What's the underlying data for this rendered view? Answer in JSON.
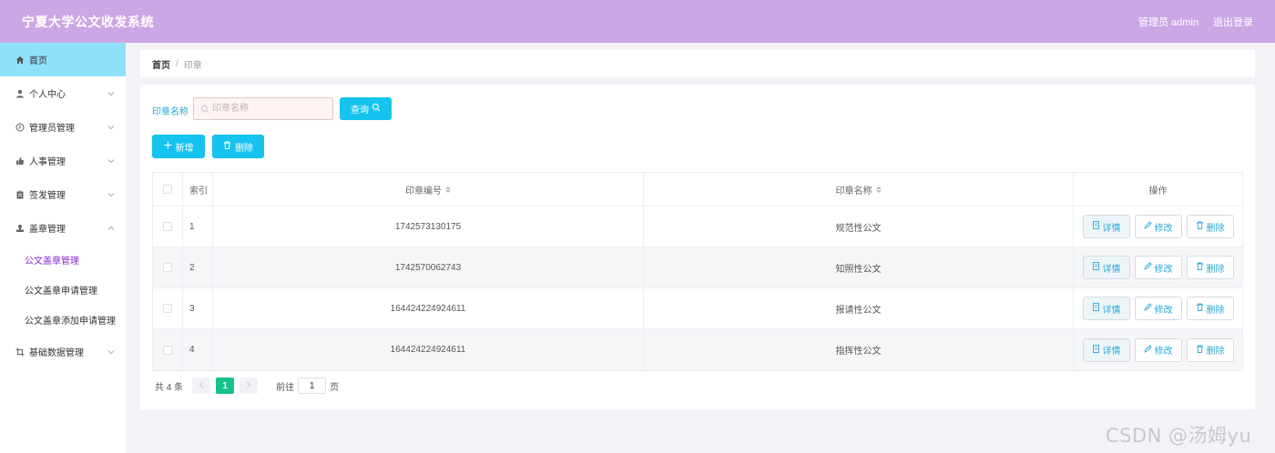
{
  "header": {
    "title": "宁夏大学公文收发系统",
    "user_label": "管理员 admin",
    "logout_label": "退出登录"
  },
  "sidebar": {
    "items": [
      {
        "label": "首页",
        "icon": "home-icon",
        "active": true
      },
      {
        "label": "个人中心",
        "icon": "user-icon"
      },
      {
        "label": "管理员管理",
        "icon": "clock-icon"
      },
      {
        "label": "人事管理",
        "icon": "thumb-icon"
      },
      {
        "label": "签发管理",
        "icon": "clipboard-icon"
      },
      {
        "label": "盖章管理",
        "icon": "stamp-icon",
        "expanded": true
      },
      {
        "label": "基础数据管理",
        "icon": "crop-icon"
      }
    ],
    "sub_items": [
      {
        "label": "公文盖章管理",
        "current": true
      },
      {
        "label": "公文盖章申请管理"
      },
      {
        "label": "公文盖章添加申请管理"
      }
    ]
  },
  "breadcrumb": {
    "home": "首页",
    "separator": "/",
    "current": "印章"
  },
  "search": {
    "label": "印章名称",
    "placeholder": "印章名称",
    "value": "",
    "query_label": "查询"
  },
  "actions": {
    "add_label": "新增",
    "delete_label": "删除"
  },
  "table": {
    "columns": [
      "索引",
      "印章编号",
      "印章名称",
      "操作"
    ],
    "rows": [
      {
        "index": "1",
        "code": "1742573130175",
        "name": "规范性公文"
      },
      {
        "index": "2",
        "code": "1742570062743",
        "name": "知照性公文"
      },
      {
        "index": "3",
        "code": "164424224924611",
        "name": "报请性公文"
      },
      {
        "index": "4",
        "code": "164424224924611",
        "name": "指挥性公文"
      }
    ],
    "row_actions": {
      "detail": "详情",
      "edit": "修改",
      "delete": "删除"
    }
  },
  "pagination": {
    "total": "共 4 条",
    "current_page": "1",
    "goto_prefix": "前往",
    "goto_value": "1",
    "goto_suffix": "页"
  },
  "watermark": "CSDN @汤姆yu",
  "colors": {
    "header_bg": "#cda6e6",
    "accent": "#16c3ef",
    "active_menu_bg": "#8ee0fb",
    "current_sub": "#8a2bd3",
    "page_active": "#18c08b"
  }
}
